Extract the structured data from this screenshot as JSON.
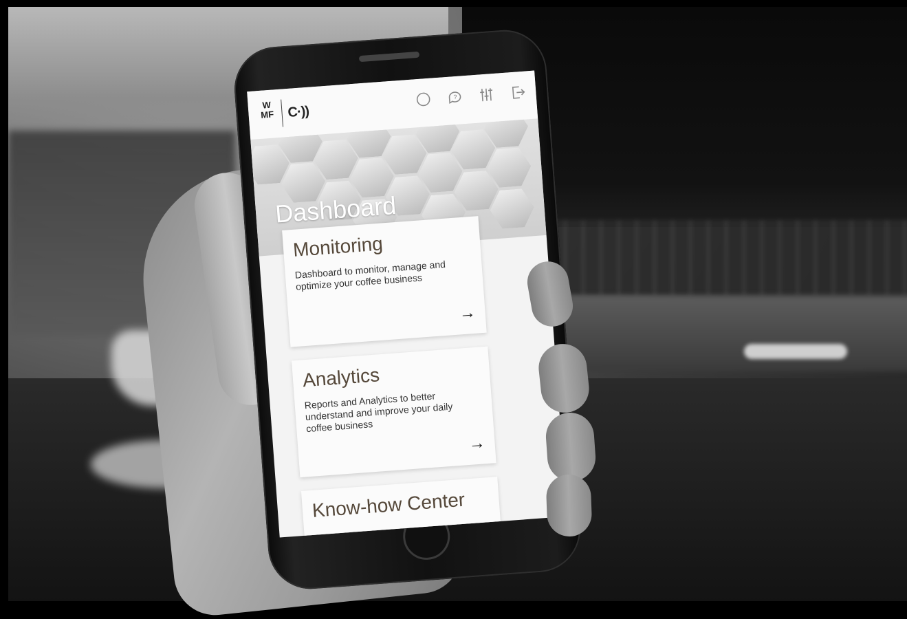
{
  "app": {
    "logo_text": "W\nMF",
    "connect_text": "C·))"
  },
  "top_icons": [
    "compass-icon",
    "chat-icon",
    "settings-sliders-icon",
    "logout-icon"
  ],
  "hero": {
    "title": "Dashboard"
  },
  "cards": [
    {
      "title": "Monitoring",
      "description": "Dashboard to monitor, manage and optimize your coffee business",
      "arrow": "→"
    },
    {
      "title": "Analytics",
      "description": "Reports and Analytics to better understand and improve your daily coffee business",
      "arrow": "→"
    },
    {
      "title": "Know-how Center"
    }
  ],
  "colors": {
    "card_title": "#55483a",
    "screen_bg": "#f3f3f3"
  }
}
